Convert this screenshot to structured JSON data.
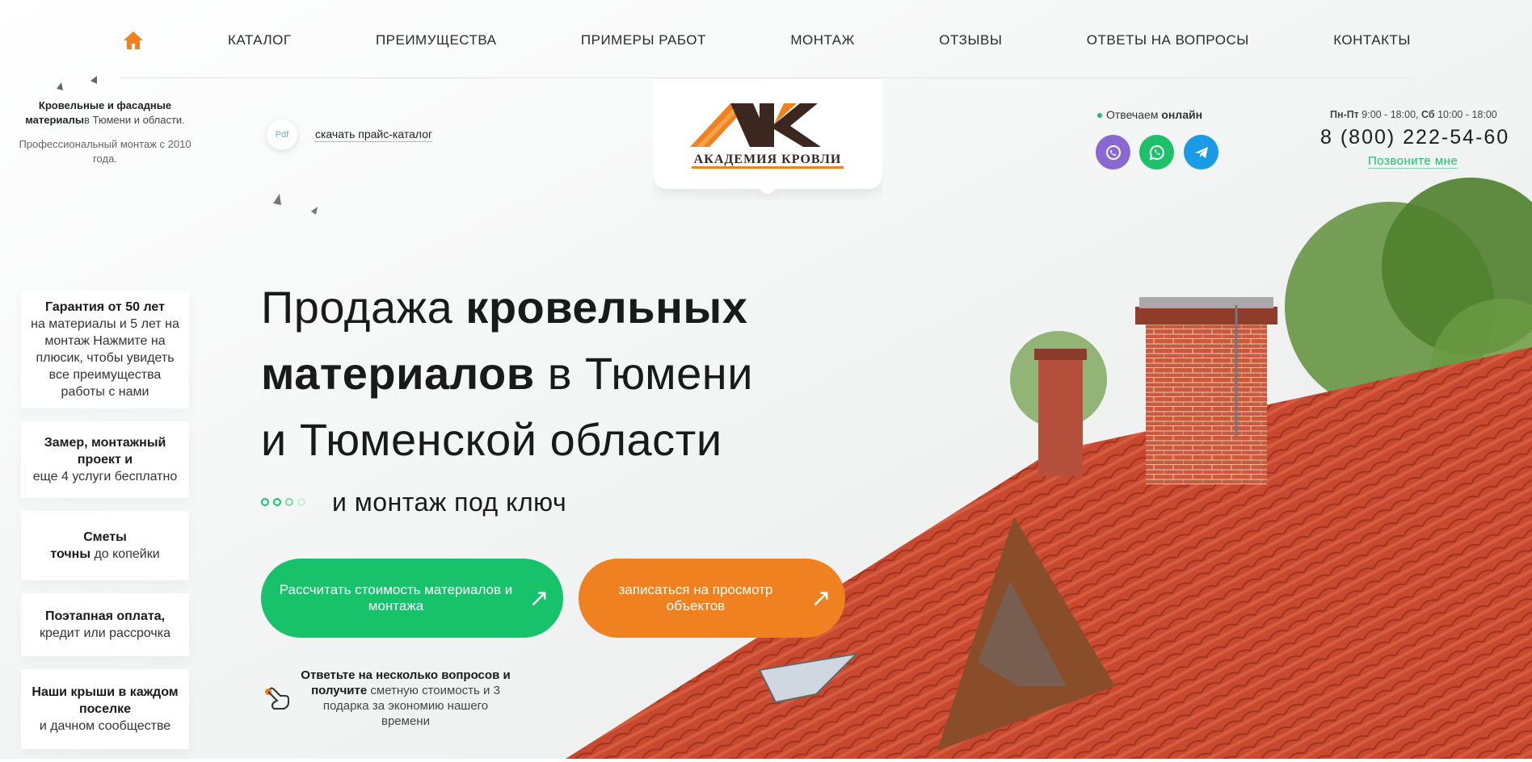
{
  "nav": {
    "items": [
      "КАТАЛОГ",
      "ПРЕИМУЩЕСТВА",
      "ПРИМЕРЫ РАБОТ",
      "МОНТАЖ",
      "ОТЗЫВЫ",
      "ОТВЕТЫ НА ВОПРОСЫ",
      "КОНТАКТЫ"
    ]
  },
  "tagline": {
    "line1_bold": "Кровельные и фасадные материалы",
    "line1_rest": "в Тюмени и области.",
    "sub": "Профессиональный монтаж с 2010 года."
  },
  "pdf": {
    "badge": "Pdf",
    "link": "скачать прайс-каталог"
  },
  "logo": {
    "text": "АКАДЕМИЯ КРОВЛИ"
  },
  "contacts": {
    "online_prefix": "Отвечаем",
    "online_bold": "онлайн",
    "hours_weekdays_label": "Пн-Пт",
    "hours_weekdays": "9:00 - 18:00,",
    "hours_sat_label": "Сб",
    "hours_sat": "10:00 - 18:00",
    "phone": "8 (800) 222-54-60",
    "callme": "Позвоните мне"
  },
  "features": [
    {
      "bold": "Гарантия от 50 лет",
      "text": "на материалы и 5 лет на монтаж Нажмите на плюсик, чтобы увидеть все преимущества работы с нами"
    },
    {
      "bold": "Замер, монтажный проект и",
      "text": "еще 4 услуги бесплатно"
    },
    {
      "bold_pre": "Сметы",
      "bold": "точны",
      "text": "до копейки"
    },
    {
      "bold": "Поэтапная оплата,",
      "text": "кредит или рассрочка"
    },
    {
      "bold": "Наши крыши в каждом поселке",
      "text": "и дачном сообществе"
    }
  ],
  "hero": {
    "l1_light": "Продажа",
    "l1_bold": "кровельных",
    "l2_bold": "материалов",
    "l2_light": "в Тюмени",
    "l3_light": "и Тюменской области",
    "sub": "и монтаж под ключ"
  },
  "cta": {
    "green": "Рассчитать стоимость материалов и монтажа",
    "orange": "записаться на просмотр объектов",
    "arrow": "↗"
  },
  "quiz": {
    "bold": "Ответьте на несколько вопросов и получите",
    "text": "сметную стоимость и 3 подарка за экономию нашего времени"
  },
  "colors": {
    "green": "#17c26b",
    "orange": "#f08120",
    "viber": "#7b5fd6",
    "whatsapp": "#1fc06a",
    "telegram": "#1b9ae6",
    "roof": "#c94b34"
  }
}
